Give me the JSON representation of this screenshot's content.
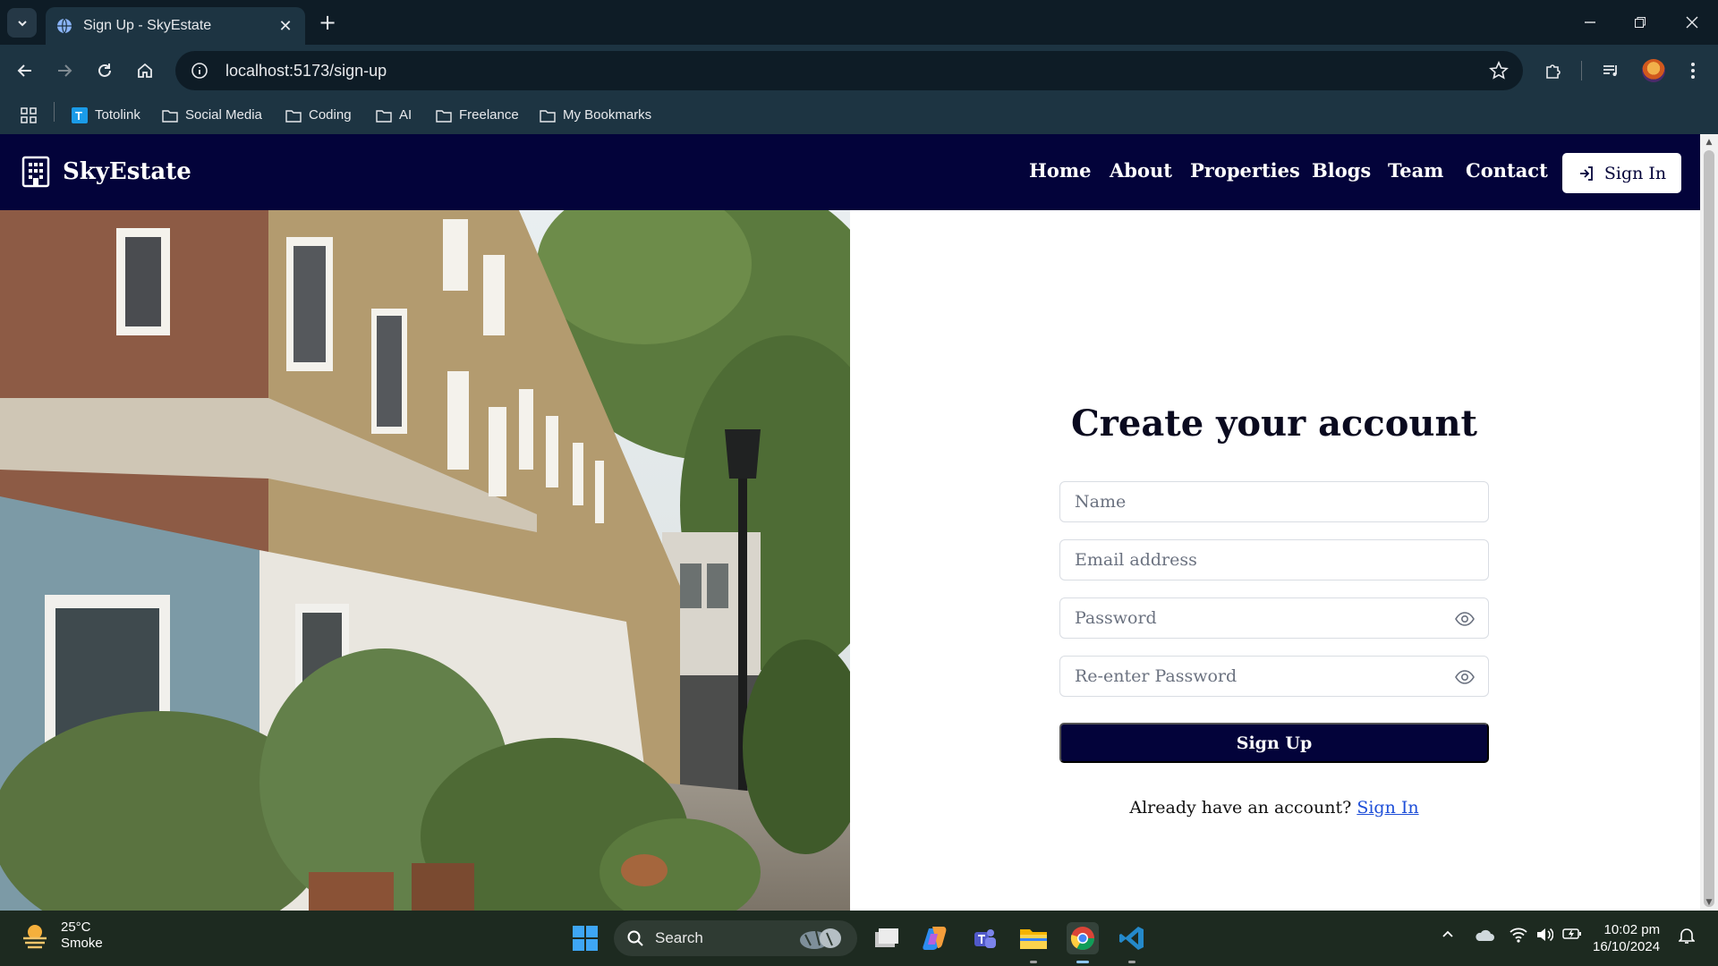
{
  "browser": {
    "tab_title": "Sign Up - SkyEstate",
    "url": "localhost:5173/sign-up",
    "bookmarks": [
      {
        "label": "Totolink",
        "icon": "totolink-favicon-icon"
      },
      {
        "label": "Social Media",
        "icon": "folder-icon"
      },
      {
        "label": "Coding",
        "icon": "folder-icon"
      },
      {
        "label": "AI",
        "icon": "folder-icon"
      },
      {
        "label": "Freelance",
        "icon": "folder-icon"
      },
      {
        "label": "My Bookmarks",
        "icon": "folder-icon"
      }
    ]
  },
  "site": {
    "brand": "SkyEstate",
    "nav": [
      "Home",
      "About",
      "Properties",
      "Blogs",
      "Team",
      "Contact"
    ],
    "signin_label": "Sign In"
  },
  "form": {
    "title": "Create your account",
    "name_placeholder": "Name",
    "email_placeholder": "Email address",
    "password_placeholder": "Password",
    "reenter_placeholder": "Re-enter Password",
    "submit_label": "Sign Up",
    "footer_text": "Already have an account? ",
    "footer_link": "Sign In"
  },
  "taskbar": {
    "temperature": "25°C",
    "condition": "Smoke",
    "search_label": "Search",
    "time": "10:02 pm",
    "date": "16/10/2024"
  },
  "colors": {
    "nav_bg": "#03033a",
    "button_bg": "#03033a",
    "link": "#1d4ed8",
    "browser_frame": "#1d3442"
  }
}
